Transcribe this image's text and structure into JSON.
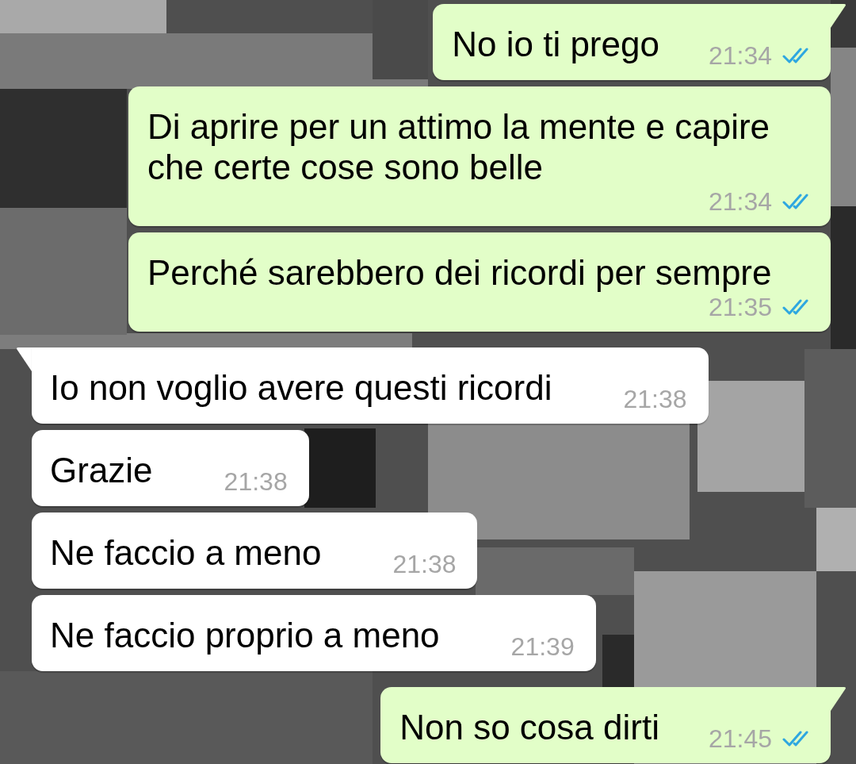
{
  "messages": [
    {
      "kind": "outgoing",
      "text": "No io ti prego",
      "time": "21:34",
      "read": true
    },
    {
      "kind": "outgoing",
      "text": "Di aprire per un attimo la mente e capire che certe cose sono belle",
      "time": "21:34",
      "read": true
    },
    {
      "kind": "outgoing",
      "text": "Perché sarebbero dei ricordi per sempre",
      "time": "21:35",
      "read": true
    },
    {
      "kind": "incoming",
      "text": "Io non voglio avere questi ricordi",
      "time": "21:38"
    },
    {
      "kind": "incoming",
      "text": "Grazie",
      "time": "21:38"
    },
    {
      "kind": "incoming",
      "text": "Ne faccio a meno",
      "time": "21:38"
    },
    {
      "kind": "incoming",
      "text": "Ne faccio proprio a meno",
      "time": "21:39"
    },
    {
      "kind": "outgoing",
      "text": "Non so cosa dirti",
      "time": "21:45",
      "read": true
    }
  ]
}
